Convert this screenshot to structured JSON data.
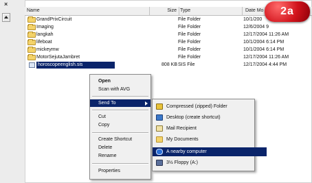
{
  "window": {
    "close_glyph": "×"
  },
  "columns": {
    "name": "Name",
    "size": "Size",
    "type": "Type",
    "date": "Date Mo"
  },
  "badge": "2a",
  "files": [
    {
      "name": "GrandPrixCircuit",
      "size": "",
      "type": "File Folder",
      "date": "10/1/200",
      "icon": "folder-icon"
    },
    {
      "name": "Imaging",
      "size": "",
      "type": "File Folder",
      "date": "12/6/2004 9",
      "icon": "folder-icon"
    },
    {
      "name": "langkah",
      "size": "",
      "type": "File Folder",
      "date": "12/17/2004 11:26 AM",
      "icon": "folder-icon"
    },
    {
      "name": "lifeboat",
      "size": "",
      "type": "File Folder",
      "date": "10/1/2004 6:14 PM",
      "icon": "folder-icon"
    },
    {
      "name": "mickeymw",
      "size": "",
      "type": "File Folder",
      "date": "10/1/2004 6:14 PM",
      "icon": "folder-icon"
    },
    {
      "name": "MotorSejutaJambret",
      "size": "",
      "type": "File Folder",
      "date": "12/17/2004 11:26 AM",
      "icon": "folder-icon"
    },
    {
      "name": "horoscopeenglish.sis",
      "size": "808 KB",
      "type": "SIS File",
      "date": "12/17/2004 4:44 PM",
      "icon": "sis-file-icon",
      "selected": true
    }
  ],
  "context_menu": {
    "items": [
      {
        "label": "Open",
        "bold": true
      },
      {
        "label": "Scan with AVG"
      },
      {
        "label": "Send To",
        "submenu": true,
        "active": true
      },
      {
        "label": "Cut"
      },
      {
        "label": "Copy"
      },
      {
        "label": "Create Shortcut"
      },
      {
        "label": "Delete"
      },
      {
        "label": "Rename"
      },
      {
        "label": "Properties"
      }
    ]
  },
  "send_to_menu": {
    "items": [
      {
        "label": "Compressed (zipped) Folder",
        "icon": "zip-folder-icon",
        "color": "#e8c23a"
      },
      {
        "label": "Desktop (create shortcut)",
        "icon": "desktop-icon",
        "color": "#3b78c9"
      },
      {
        "label": "Mail Recipient",
        "icon": "mail-icon",
        "color": "#f2e2a6"
      },
      {
        "label": "My Documents",
        "icon": "my-documents-icon",
        "color": "#f4d36a"
      },
      {
        "label": "A nearby computer",
        "icon": "bluetooth-icon",
        "color": "#2b6fd6",
        "active": true
      },
      {
        "label": "3½ Floppy (A:)",
        "icon": "floppy-icon",
        "color": "#5a6f9b"
      }
    ]
  },
  "colors": {
    "selection": "#0a246a",
    "badge": "#d1121b",
    "menu_bg": "#f0f0f0"
  }
}
